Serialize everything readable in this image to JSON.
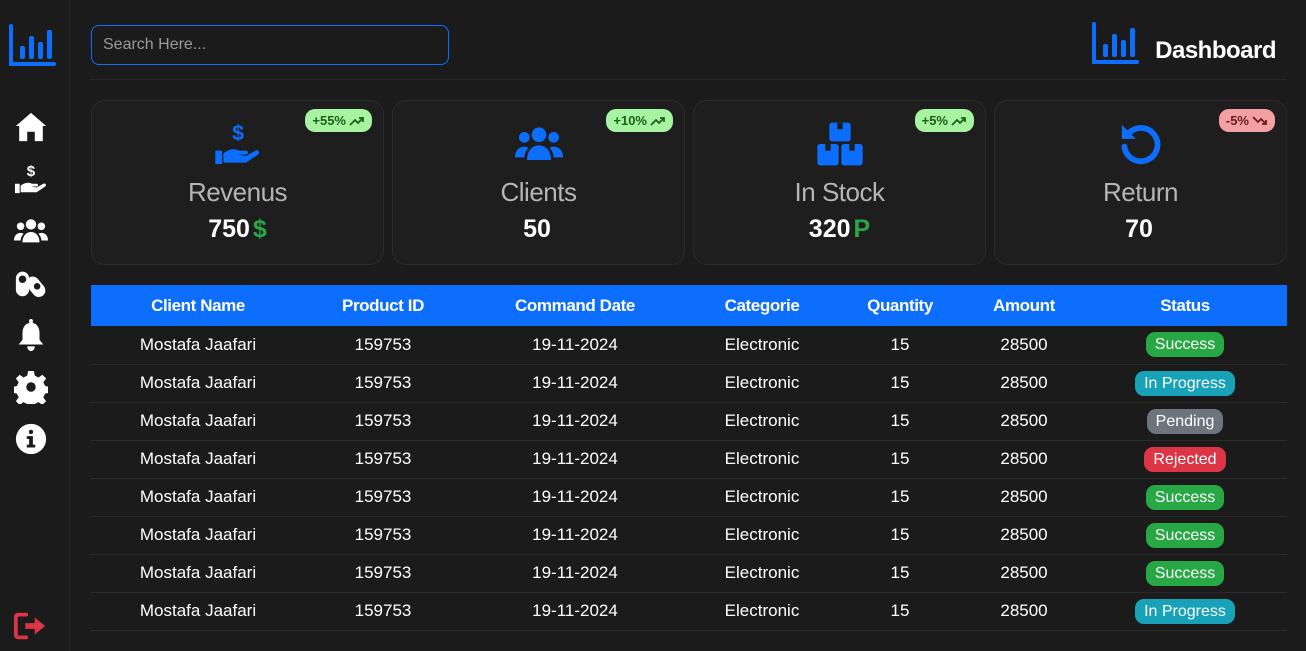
{
  "search": {
    "placeholder": "Search Here..."
  },
  "header": {
    "title": "Dashboard"
  },
  "sidebar": {
    "items": [
      {
        "name": "home",
        "icon": "home-icon"
      },
      {
        "name": "payments",
        "icon": "hand-dollar-icon"
      },
      {
        "name": "clients",
        "icon": "users-icon"
      },
      {
        "name": "products",
        "icon": "pills-icon"
      },
      {
        "name": "notifications",
        "icon": "bell-icon"
      },
      {
        "name": "settings",
        "icon": "gear-icon"
      },
      {
        "name": "info",
        "icon": "info-icon"
      }
    ],
    "logout_icon": "logout-icon"
  },
  "cards": [
    {
      "title": "Revenus",
      "value": "750",
      "unit": "$",
      "badge": "+55%",
      "trend": "up",
      "icon": "hand-dollar-icon"
    },
    {
      "title": "Clients",
      "value": "50",
      "unit": "",
      "badge": "+10%",
      "trend": "up",
      "icon": "users-icon"
    },
    {
      "title": "In Stock",
      "value": "320",
      "unit": "P",
      "badge": "+5%",
      "trend": "up",
      "icon": "boxes-icon"
    },
    {
      "title": "Return",
      "value": "70",
      "unit": "",
      "badge": "-5%",
      "trend": "down",
      "icon": "rotate-icon"
    }
  ],
  "table": {
    "columns": [
      "Client Name",
      "Product ID",
      "Command Date",
      "Categorie",
      "Quantity",
      "Amount",
      "Status"
    ],
    "rows": [
      [
        "Mostafa Jaafari",
        "159753",
        "19-11-2024",
        "Electronic",
        "15",
        "28500",
        "Success"
      ],
      [
        "Mostafa Jaafari",
        "159753",
        "19-11-2024",
        "Electronic",
        "15",
        "28500",
        "In Progress"
      ],
      [
        "Mostafa Jaafari",
        "159753",
        "19-11-2024",
        "Electronic",
        "15",
        "28500",
        "Pending"
      ],
      [
        "Mostafa Jaafari",
        "159753",
        "19-11-2024",
        "Electronic",
        "15",
        "28500",
        "Rejected"
      ],
      [
        "Mostafa Jaafari",
        "159753",
        "19-11-2024",
        "Electronic",
        "15",
        "28500",
        "Success"
      ],
      [
        "Mostafa Jaafari",
        "159753",
        "19-11-2024",
        "Electronic",
        "15",
        "28500",
        "Success"
      ],
      [
        "Mostafa Jaafari",
        "159753",
        "19-11-2024",
        "Electronic",
        "15",
        "28500",
        "Success"
      ],
      [
        "Mostafa Jaafari",
        "159753",
        "19-11-2024",
        "Electronic",
        "15",
        "28500",
        "In Progress"
      ]
    ]
  },
  "colors": {
    "accent": "#0d6efd",
    "success": "#28a745",
    "in_progress": "#17a2b8",
    "pending": "#6c757d",
    "rejected": "#dc3545",
    "badge_up": "#a6f3a0",
    "badge_down": "#f3a0a3",
    "logout": "#dc3545"
  }
}
